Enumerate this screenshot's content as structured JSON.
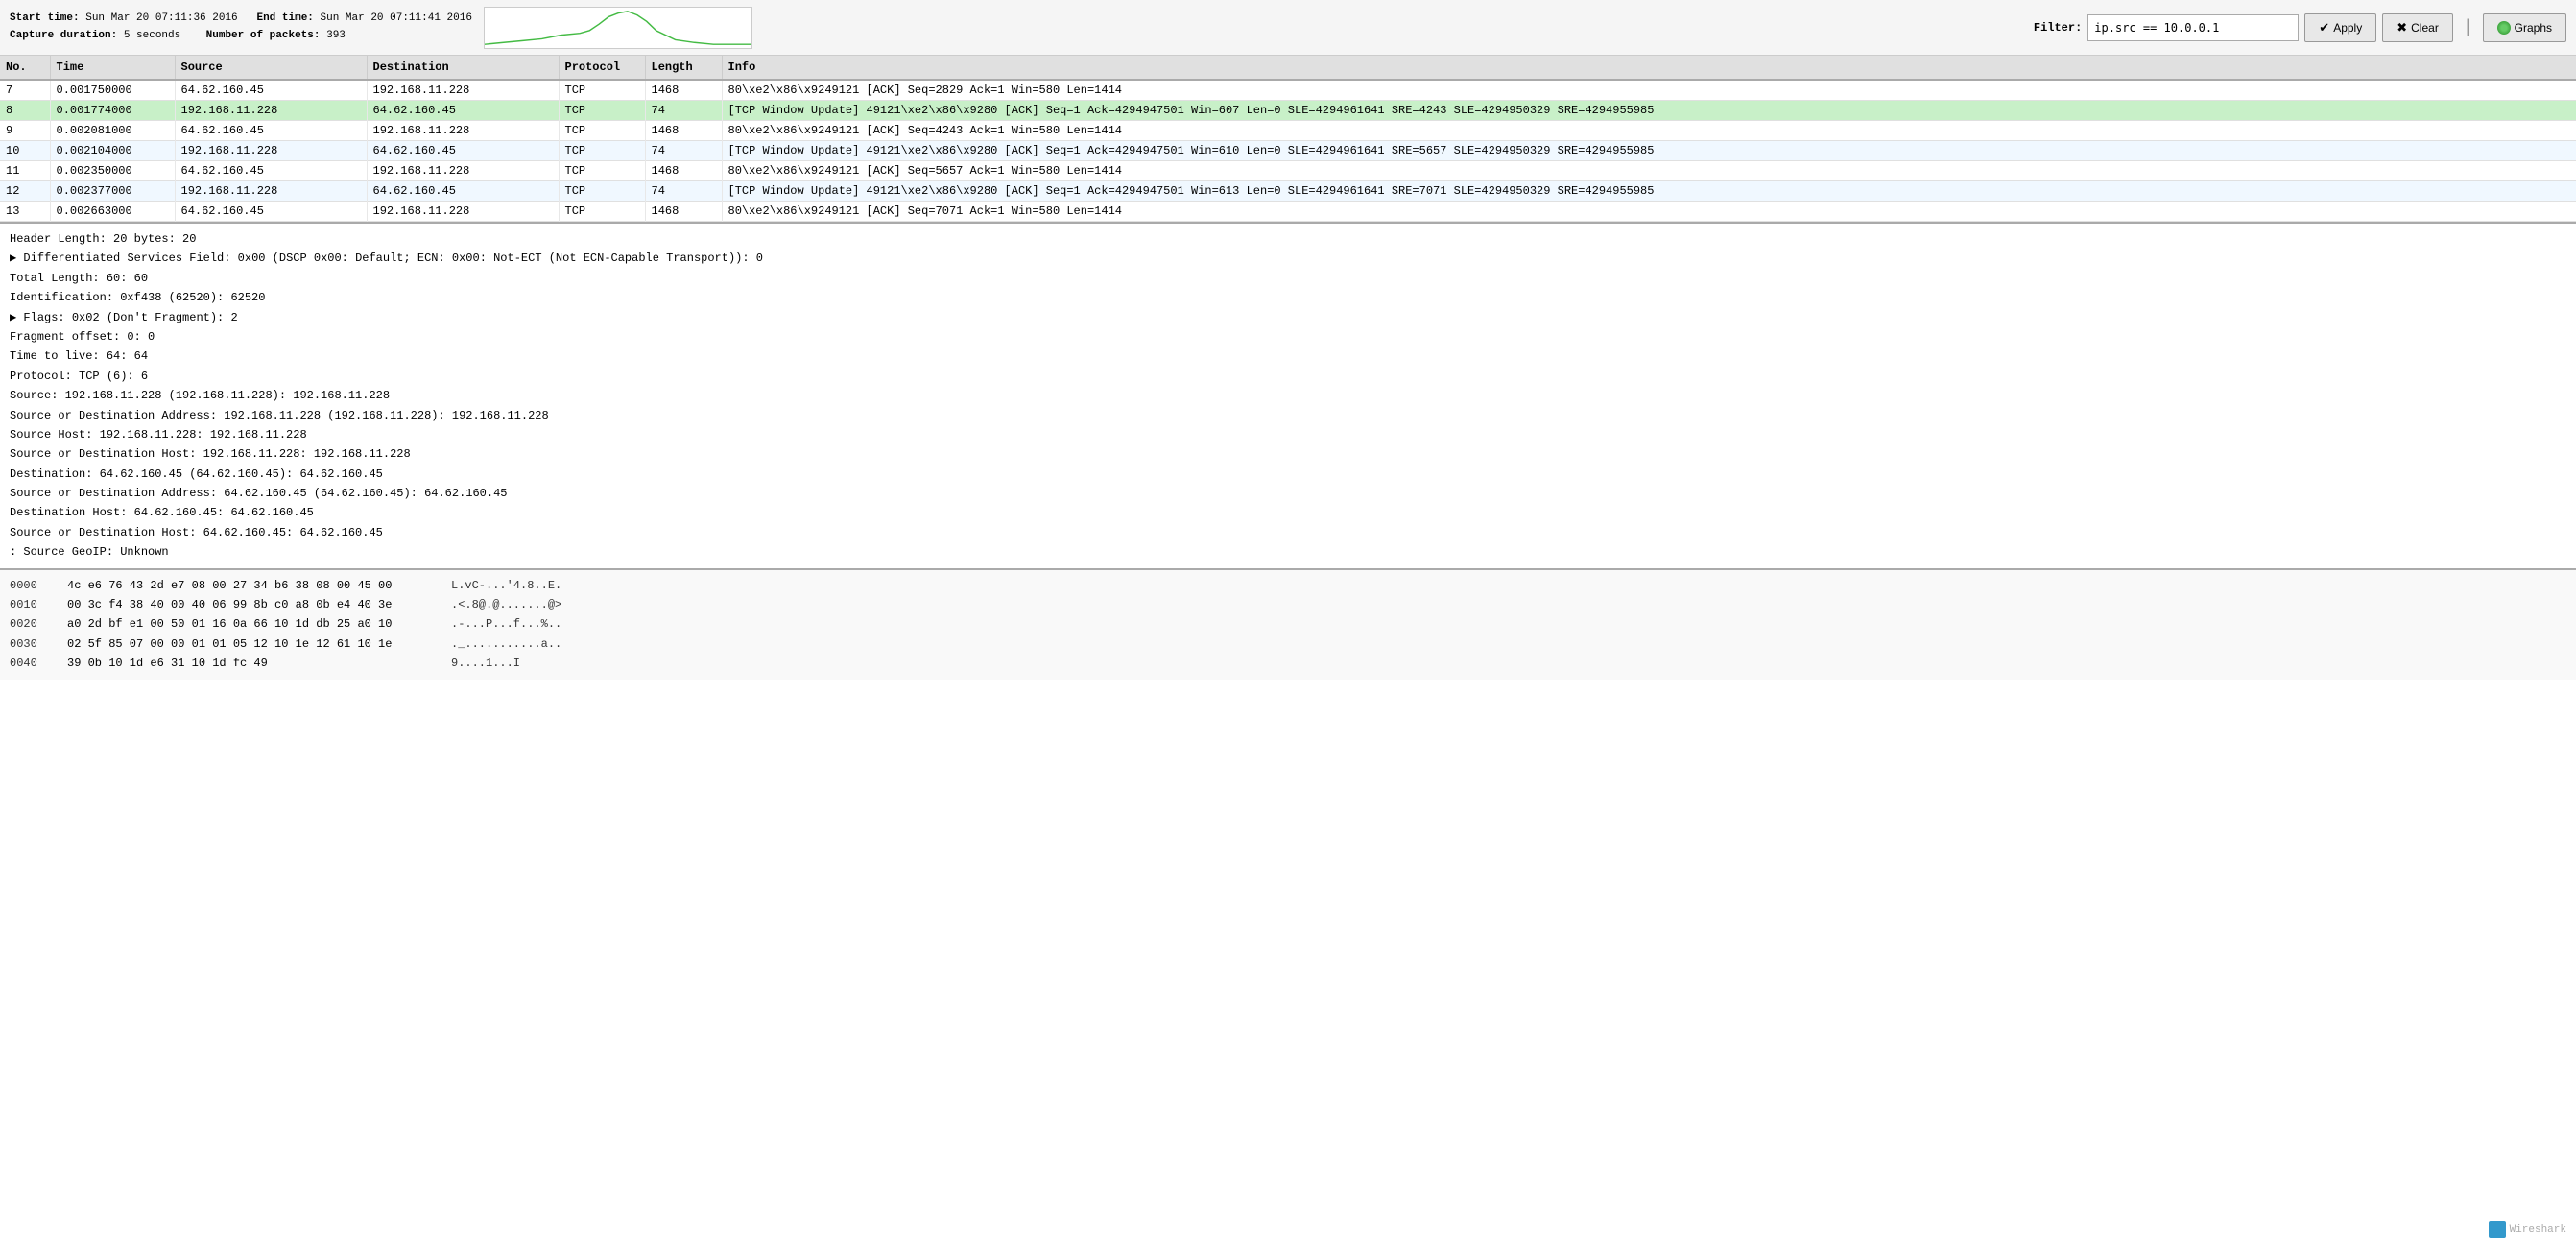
{
  "header": {
    "start_time_label": "Start time:",
    "start_time_value": "Sun Mar 20 07:11:36 2016",
    "end_time_label": "End time:",
    "end_time_value": "Sun Mar 20 07:11:41 2016",
    "capture_duration_label": "Capture duration:",
    "capture_duration_value": "5 seconds",
    "num_packets_label": "Number of packets:",
    "num_packets_value": "393",
    "filter_label": "Filter:",
    "filter_value": "ip.src == 10.0.0.1",
    "apply_label": "Apply",
    "clear_label": "Clear",
    "graphs_label": "Graphs"
  },
  "table": {
    "columns": [
      "No.",
      "Time",
      "Source",
      "Destination",
      "Protocol",
      "Length",
      "Info"
    ],
    "rows": [
      {
        "no": "7",
        "time": "0.001750000",
        "src": "64.62.160.45",
        "dst": "192.168.11.228",
        "proto": "TCP",
        "len": "1468",
        "info": "80\\xe2\\x86\\x9249121 [ACK] Seq=2829 Ack=1 Win=580 Len=1414",
        "highlight": false
      },
      {
        "no": "8",
        "time": "0.001774000",
        "src": "192.168.11.228",
        "dst": "64.62.160.45",
        "proto": "TCP",
        "len": "74",
        "info": "[TCP Window Update] 49121\\xe2\\x86\\x9280 [ACK] Seq=1 Ack=4294947501 Win=607 Len=0 SLE=4294961641 SRE=4243 SLE=4294950329 SRE=4294955985",
        "highlight": true
      },
      {
        "no": "9",
        "time": "0.002081000",
        "src": "64.62.160.45",
        "dst": "192.168.11.228",
        "proto": "TCP",
        "len": "1468",
        "info": "80\\xe2\\x86\\x9249121 [ACK] Seq=4243 Ack=1 Win=580 Len=1414",
        "highlight": false
      },
      {
        "no": "10",
        "time": "0.002104000",
        "src": "192.168.11.228",
        "dst": "64.62.160.45",
        "proto": "TCP",
        "len": "74",
        "info": "[TCP Window Update] 49121\\xe2\\x86\\x9280 [ACK] Seq=1 Ack=4294947501 Win=610 Len=0 SLE=4294961641 SRE=5657 SLE=4294950329 SRE=4294955985",
        "highlight": false
      },
      {
        "no": "11",
        "time": "0.002350000",
        "src": "64.62.160.45",
        "dst": "192.168.11.228",
        "proto": "TCP",
        "len": "1468",
        "info": "80\\xe2\\x86\\x9249121 [ACK] Seq=5657 Ack=1 Win=580 Len=1414",
        "highlight": false
      },
      {
        "no": "12",
        "time": "0.002377000",
        "src": "192.168.11.228",
        "dst": "64.62.160.45",
        "proto": "TCP",
        "len": "74",
        "info": "[TCP Window Update] 49121\\xe2\\x86\\x9280 [ACK] Seq=1 Ack=4294947501 Win=613 Len=0 SLE=4294961641 SRE=7071 SLE=4294950329 SRE=4294955985",
        "highlight": false
      },
      {
        "no": "13",
        "time": "0.002663000",
        "src": "64.62.160.45",
        "dst": "192.168.11.228",
        "proto": "TCP",
        "len": "1468",
        "info": "80\\xe2\\x86\\x9249121 [ACK] Seq=7071 Ack=1 Win=580 Len=1414",
        "highlight": false
      }
    ]
  },
  "detail": {
    "lines": [
      "Header Length: 20 bytes: 20",
      "▶ Differentiated Services Field: 0x00 (DSCP 0x00: Default; ECN: 0x00: Not-ECT (Not ECN-Capable Transport)): 0",
      "Total Length: 60: 60",
      "Identification: 0xf438 (62520): 62520",
      "▶ Flags: 0x02 (Don't Fragment): 2",
      "Fragment offset: 0: 0",
      "Time to live: 64: 64",
      "Protocol: TCP (6): 6",
      "Source: 192.168.11.228 (192.168.11.228): 192.168.11.228",
      "Source or Destination Address: 192.168.11.228 (192.168.11.228): 192.168.11.228",
      "Source Host: 192.168.11.228: 192.168.11.228",
      "Source or Destination Host: 192.168.11.228: 192.168.11.228",
      "Destination: 64.62.160.45 (64.62.160.45): 64.62.160.45",
      "Source or Destination Address: 64.62.160.45 (64.62.160.45): 64.62.160.45",
      "Destination Host: 64.62.160.45: 64.62.160.45",
      "Source or Destination Host: 64.62.160.45: 64.62.160.45",
      ": Source GeoIP: Unknown"
    ]
  },
  "hex": {
    "rows": [
      {
        "offset": "0000",
        "bytes": "4c e6 76 43 2d e7 08 00 27 34 b6 38 08 00 45 00",
        "ascii": "L.vC-...'4.8..E."
      },
      {
        "offset": "0010",
        "bytes": "00 3c f4 38 40 00 40 06 99 8b c0 a8 0b e4 40 3e",
        "ascii": ".<.8@.@.......@>"
      },
      {
        "offset": "0020",
        "bytes": "a0 2d bf e1 00 50 01 16 0a 66 10 1d db 25 a0 10",
        "ascii": ".-...P...f...%.."
      },
      {
        "offset": "0030",
        "bytes": "02 5f 85 07 00 00 01 01 05 12 10 1e 12 61 10 1e",
        "ascii": "._...........a.."
      },
      {
        "offset": "0040",
        "bytes": "39 0b 10 1d e6 31 10 1d fc 49",
        "ascii": "9....1...I"
      }
    ]
  },
  "watermark": {
    "text": "Wireshark"
  }
}
